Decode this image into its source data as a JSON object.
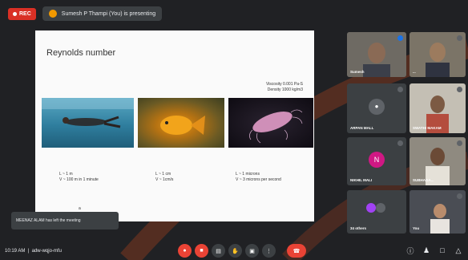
{
  "topbar": {
    "record_label": "REC",
    "presenting_text": "Sumesh P Thampi (You) is presenting"
  },
  "slide": {
    "title": "Reynolds number",
    "viscosity_line1": "Viscosity 0.001 Pa-S",
    "viscosity_line2": "Density 1000 kg/m3",
    "captions": [
      {
        "l1": "L ~ 1 m",
        "l2": "V ~ 100 m in 1 minute"
      },
      {
        "l1": "L ~ 1 cm",
        "l2": "V ~ 1cm/s"
      },
      {
        "l1": "L ~ 1 microns",
        "l2": "V ~ 3 microns per second"
      }
    ],
    "bullet": "a"
  },
  "participants": [
    {
      "name": "Sumesh",
      "kind": "video"
    },
    {
      "name": "...",
      "kind": "video"
    },
    {
      "name": "ARPAN MALL",
      "kind": "icon",
      "initial": ""
    },
    {
      "name": "SWATHI MAKAM",
      "kind": "video"
    },
    {
      "name": "NIKHIL MALI",
      "kind": "avatar",
      "initial": "N",
      "color": "#d01884"
    },
    {
      "name": "SUBHAGA...",
      "kind": "video"
    },
    {
      "name": "34 others",
      "kind": "others"
    },
    {
      "name": "You",
      "kind": "video"
    }
  ],
  "toast": {
    "text": "MEENAZ ALAM has left the meeting"
  },
  "bottombar": {
    "time": "10:19 AM",
    "meeting_code": "adw-wqjo-mfu"
  }
}
